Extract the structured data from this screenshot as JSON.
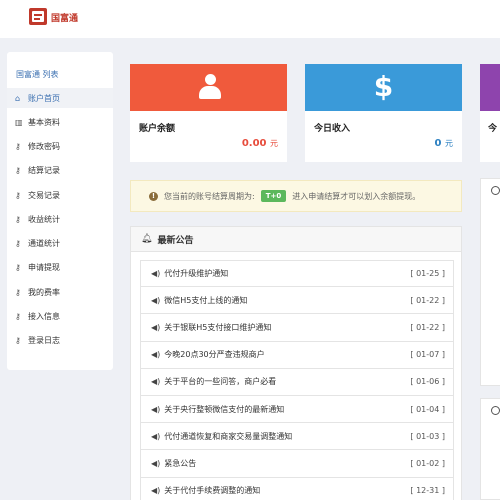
{
  "header": {
    "brand": "国富通"
  },
  "sidebar": {
    "title": "国富通 列表",
    "items": [
      {
        "label": "账户首页",
        "icon": "home-icon",
        "active": true
      },
      {
        "label": "基本资料",
        "icon": "bar-chart-icon"
      },
      {
        "label": "修改密码",
        "icon": "key-icon"
      },
      {
        "label": "结算记录",
        "icon": "key-icon"
      },
      {
        "label": "交易记录",
        "icon": "key-icon"
      },
      {
        "label": "收益统计",
        "icon": "key-icon"
      },
      {
        "label": "通道统计",
        "icon": "key-icon"
      },
      {
        "label": "申请提现",
        "icon": "key-icon"
      },
      {
        "label": "我的费率",
        "icon": "key-icon"
      },
      {
        "label": "接入信息",
        "icon": "key-icon"
      },
      {
        "label": "登录日志",
        "icon": "key-icon"
      }
    ]
  },
  "cards": [
    {
      "label": "账户余额",
      "value": "0.00",
      "unit": "元",
      "color": "#f05a3c",
      "value_color": "#e74c3c"
    },
    {
      "label": "今日收入",
      "value": "0",
      "unit": "元",
      "color": "#3a9ad9",
      "value_color": "#2a7fc1"
    },
    {
      "label": "今",
      "color": "#8e44ad"
    }
  ],
  "notice": {
    "text_before": "您当前的账号结算周期为:",
    "badge": "T+0",
    "text_after": "进入申请结算才可以划入余额提现。"
  },
  "announcements": {
    "title": "最新公告",
    "items": [
      {
        "title": "代付升级维护通知",
        "date": "[ 01-25 ]"
      },
      {
        "title": "微信H5支付上线的通知",
        "date": "[ 01-22 ]"
      },
      {
        "title": "关于银联H5支付接口维护通知",
        "date": "[ 01-22 ]"
      },
      {
        "title": "今晚20点30分严查违规商户",
        "date": "[ 01-07 ]"
      },
      {
        "title": "关于平台的一些问答，商户必看",
        "date": "[ 01-06 ]"
      },
      {
        "title": "关于央行整顿微信支付的最新通知",
        "date": "[ 01-04 ]"
      },
      {
        "title": "代付通道恢复和商家交易量调整通知",
        "date": "[ 01-03 ]"
      },
      {
        "title": "紧急公告",
        "date": "[ 01-02 ]"
      },
      {
        "title": "关于代付手续费调整的通知",
        "date": "[ 12-31 ]"
      }
    ]
  }
}
